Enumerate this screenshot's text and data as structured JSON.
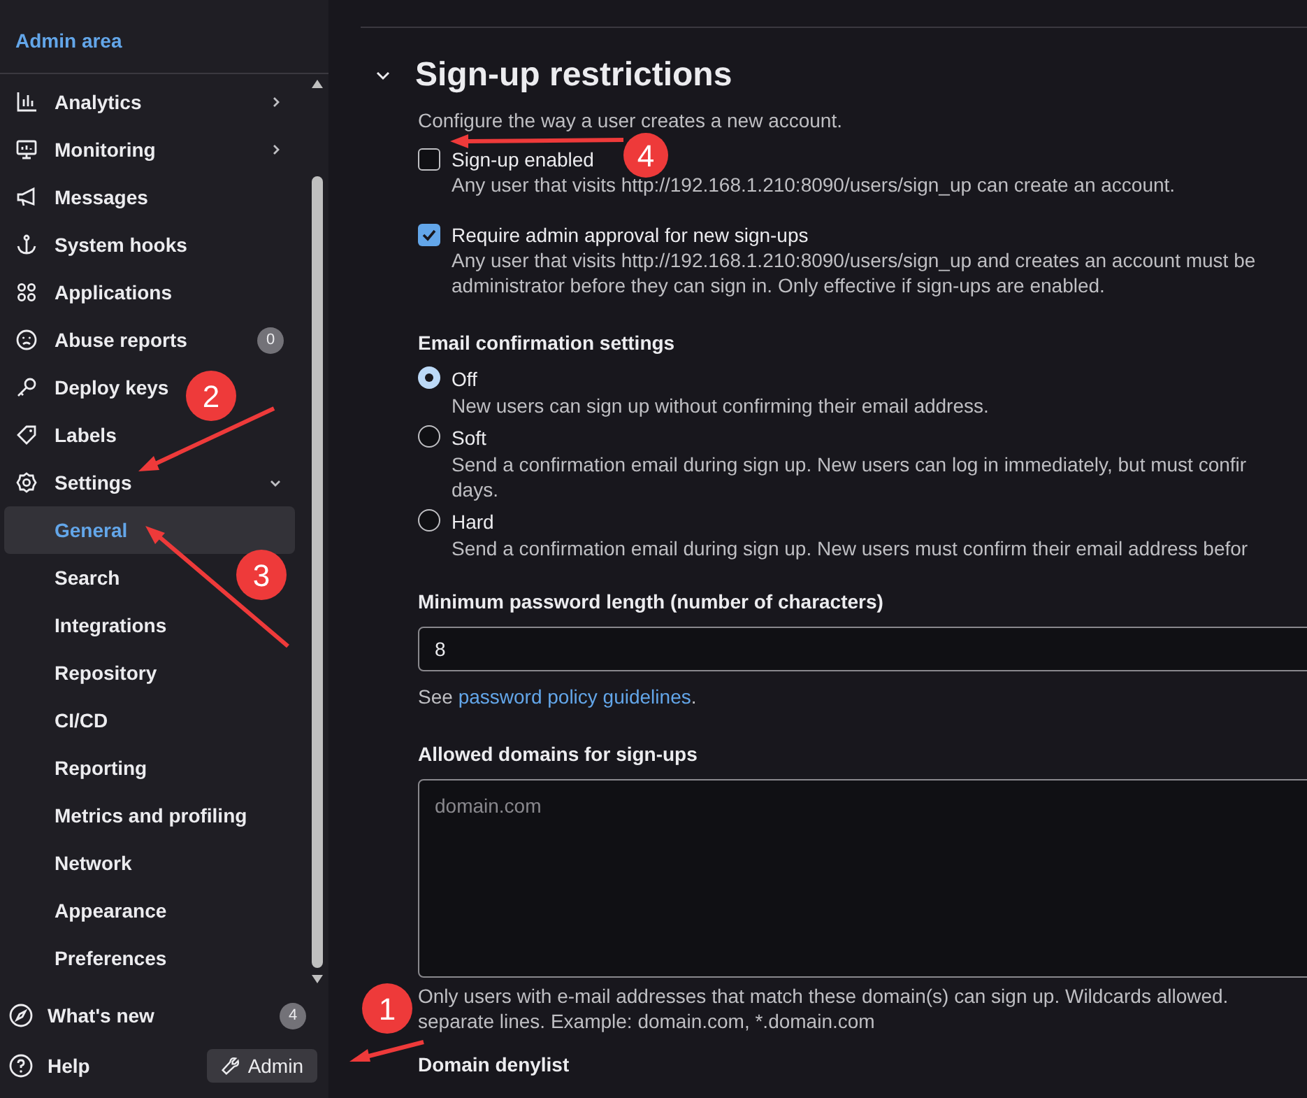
{
  "sidebar": {
    "title": "Admin area",
    "items": [
      {
        "label": "Analytics",
        "expanded": false
      },
      {
        "label": "Monitoring",
        "expanded": false
      },
      {
        "label": "Messages"
      },
      {
        "label": "System hooks"
      },
      {
        "label": "Applications"
      },
      {
        "label": "Abuse reports",
        "badge": "0"
      },
      {
        "label": "Deploy keys"
      },
      {
        "label": "Labels"
      },
      {
        "label": "Settings",
        "expanded": true,
        "children": [
          {
            "label": "General",
            "selected": true
          },
          {
            "label": "Search",
            "selected": false
          },
          {
            "label": "Integrations",
            "selected": false
          },
          {
            "label": "Repository",
            "selected": false
          },
          {
            "label": "CI/CD",
            "selected": false
          },
          {
            "label": "Reporting",
            "selected": false
          },
          {
            "label": "Metrics and profiling",
            "selected": false
          },
          {
            "label": "Network",
            "selected": false
          },
          {
            "label": "Appearance",
            "selected": false
          },
          {
            "label": "Preferences",
            "selected": false
          }
        ]
      }
    ],
    "footer": [
      {
        "label": "What's new",
        "badge": "4"
      },
      {
        "label": "Help",
        "button": "Admin"
      }
    ]
  },
  "section": {
    "title": "Sign-up restrictions",
    "expanded": true,
    "description": "Configure the way a user creates a new account.",
    "checkboxes": [
      {
        "label": "Sign-up enabled",
        "checked": false,
        "lines": [
          "Any user that visits http://192.168.1.210:8090/users/sign_up can create an account."
        ]
      },
      {
        "label": "Require admin approval for new sign-ups",
        "checked": true,
        "lines": [
          "Any user that visits http://192.168.1.210:8090/users/sign_up and creates an account must be",
          "administrator before they can sign in. Only effective if sign-ups are enabled."
        ]
      }
    ],
    "email_confirmation": {
      "title": "Email confirmation settings",
      "options": [
        {
          "label": "Off",
          "selected": true,
          "lines": [
            "New users can sign up without confirming their email address."
          ]
        },
        {
          "label": "Soft",
          "selected": false,
          "lines": [
            "Send a confirmation email during sign up. New users can log in immediately, but must confir",
            "days."
          ]
        },
        {
          "label": "Hard",
          "selected": false,
          "lines": [
            "Send a confirmation email during sign up. New users must confirm their email address befor"
          ]
        }
      ]
    },
    "min_password": {
      "title": "Minimum password length (number of characters)",
      "value": "8",
      "help_prefix": "See",
      "help_link": "password policy guidelines",
      "help_suffix": "."
    },
    "allowed_domains": {
      "title": "Allowed domains for sign-ups",
      "placeholder": "domain.com",
      "lines": [
        "Only users with e-mail addresses that match these domain(s) can sign up. Wildcards allowed.",
        "separate lines. Example: domain.com, *.domain.com"
      ]
    },
    "denylist": {
      "title": "Domain denylist"
    }
  },
  "annotations": [
    {
      "label": "1"
    },
    {
      "label": "2"
    },
    {
      "label": "3"
    },
    {
      "label": "4"
    }
  ]
}
